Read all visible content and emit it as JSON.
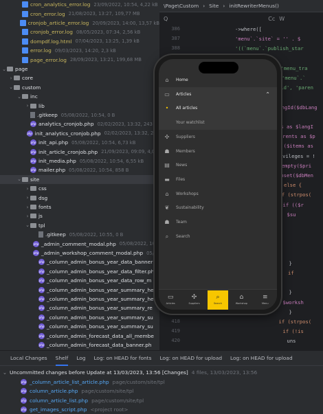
{
  "tree": {
    "rows": [
      {
        "name": "cron_analytics_error.log",
        "meta": "23/09/2022, 10:54, 4,22 kB",
        "kind": "log",
        "yellow": true,
        "indent": 24,
        "chev": ""
      },
      {
        "name": "cron_error.log",
        "meta": "21/08/2023, 13:27, 109,77 MB",
        "kind": "log",
        "yellow": true,
        "indent": 24,
        "chev": ""
      },
      {
        "name": "cronjob_article_error.log",
        "meta": "20/09/2023, 14:00, 13,57 kB",
        "kind": "log",
        "yellow": true,
        "indent": 24,
        "chev": ""
      },
      {
        "name": "cronjob_error.log",
        "meta": "08/05/2023, 07:34, 2,56 kB",
        "kind": "log",
        "yellow": true,
        "indent": 24,
        "chev": ""
      },
      {
        "name": "dompdf.log.html",
        "meta": "07/04/2023, 13:25, 1,39 kB",
        "kind": "html",
        "yellow": true,
        "indent": 24,
        "chev": ""
      },
      {
        "name": "error.log",
        "meta": "09/03/2023, 14:20, 2,3 kB",
        "kind": "log",
        "yellow": true,
        "indent": 24,
        "chev": ""
      },
      {
        "name": "page_error.log",
        "meta": "28/09/2023, 13:21, 199,68 MB",
        "kind": "log",
        "yellow": true,
        "indent": 24,
        "chev": ""
      },
      {
        "name": "page",
        "meta": "",
        "kind": "folder",
        "yellow": false,
        "indent": 2,
        "chev": "⌄"
      },
      {
        "name": "core",
        "meta": "",
        "kind": "folder",
        "yellow": false,
        "indent": 12,
        "chev": "›"
      },
      {
        "name": "custom",
        "meta": "",
        "kind": "folder",
        "yellow": false,
        "indent": 12,
        "chev": "⌄"
      },
      {
        "name": "inc",
        "meta": "",
        "kind": "folder",
        "yellow": false,
        "indent": 24,
        "chev": "⌄"
      },
      {
        "name": "lib",
        "meta": "",
        "kind": "folder",
        "yellow": false,
        "indent": 36,
        "chev": "›"
      },
      {
        "name": ".gitkeep",
        "meta": "05/08/2022, 10:54, 0 B",
        "kind": "file",
        "yellow": false,
        "indent": 36,
        "chev": ""
      },
      {
        "name": "analytics_cronjob.php",
        "meta": "02/02/2023, 13:32, 243",
        "kind": "php",
        "yellow": false,
        "indent": 36,
        "chev": ""
      },
      {
        "name": "init_analytics_cronjob.php",
        "meta": "02/02/2023, 13:32, 243",
        "kind": "php",
        "yellow": false,
        "indent": 36,
        "chev": ""
      },
      {
        "name": "init_api.php",
        "meta": "05/08/2022, 10:54, 6,73 kB",
        "kind": "php",
        "yellow": false,
        "indent": 36,
        "chev": ""
      },
      {
        "name": "init_article_cronjob.php",
        "meta": "21/09/2023, 09:09, 4,0",
        "kind": "php",
        "yellow": false,
        "indent": 36,
        "chev": ""
      },
      {
        "name": "init_media.php",
        "meta": "05/08/2022, 10:54, 6,55 kB",
        "kind": "php",
        "yellow": false,
        "indent": 36,
        "chev": ""
      },
      {
        "name": "mailer.php",
        "meta": "05/08/2022, 10:54, 858 B",
        "kind": "php",
        "yellow": false,
        "indent": 36,
        "chev": ""
      },
      {
        "name": "site",
        "meta": "",
        "kind": "folder",
        "yellow": false,
        "indent": 24,
        "chev": "⌄",
        "sel": true
      },
      {
        "name": "css",
        "meta": "",
        "kind": "folder",
        "yellow": false,
        "indent": 36,
        "chev": "›"
      },
      {
        "name": "dsg",
        "meta": "",
        "kind": "folder",
        "yellow": false,
        "indent": 36,
        "chev": "›"
      },
      {
        "name": "fonts",
        "meta": "",
        "kind": "folder",
        "yellow": false,
        "indent": 36,
        "chev": "›"
      },
      {
        "name": "js",
        "meta": "",
        "kind": "folder",
        "yellow": false,
        "indent": 36,
        "chev": "›"
      },
      {
        "name": "tpl",
        "meta": "",
        "kind": "folder",
        "yellow": false,
        "indent": 36,
        "chev": "⌄"
      },
      {
        "name": ".gitkeep",
        "meta": "05/08/2022, 10:55, 0 B",
        "kind": "file",
        "yellow": false,
        "indent": 48,
        "chev": ""
      },
      {
        "name": "_admin_comment_modal.php",
        "meta": "05/08/2022, 10:54, 1,36 kB",
        "kind": "php",
        "yellow": false,
        "indent": 48,
        "chev": ""
      },
      {
        "name": "_admin_workshop_comment_modal.php",
        "meta": "05/08/2022",
        "kind": "php",
        "yellow": false,
        "indent": 48,
        "chev": ""
      },
      {
        "name": "_column_admin_bonus_year_data_banner",
        "meta": "",
        "kind": "php",
        "yellow": false,
        "indent": 48,
        "chev": ""
      },
      {
        "name": "_column_admin_bonus_year_data_filter.ph",
        "meta": "",
        "kind": "php",
        "yellow": false,
        "indent": 48,
        "chev": ""
      },
      {
        "name": "_column_admin_bonus_year_data_row_m",
        "meta": "",
        "kind": "php",
        "yellow": false,
        "indent": 48,
        "chev": ""
      },
      {
        "name": "_column_admin_bonus_year_summary_he",
        "meta": "",
        "kind": "php",
        "yellow": false,
        "indent": 48,
        "chev": ""
      },
      {
        "name": "_column_admin_bonus_year_summary_he",
        "meta": "",
        "kind": "php",
        "yellow": false,
        "indent": 48,
        "chev": ""
      },
      {
        "name": "_column_admin_bonus_year_summary_re",
        "meta": "",
        "kind": "php",
        "yellow": false,
        "indent": 48,
        "chev": ""
      },
      {
        "name": "_column_admin_bonus_year_summary_su",
        "meta": "",
        "kind": "php",
        "yellow": false,
        "indent": 48,
        "chev": ""
      },
      {
        "name": "_column_admin_bonus_year_summary_su",
        "meta": "",
        "kind": "php",
        "yellow": false,
        "indent": 48,
        "chev": ""
      },
      {
        "name": "_column_admin_forecast_data_all_membe",
        "meta": "",
        "kind": "php",
        "yellow": false,
        "indent": 48,
        "chev": ""
      },
      {
        "name": "_column_admin_forecast_data_banner.ph",
        "meta": "",
        "kind": "php",
        "yellow": false,
        "indent": 48,
        "chev": ""
      }
    ]
  },
  "editor": {
    "breadcrumb": [
      "\\Page\\Custom",
      "Site",
      "initRewriterMenus()"
    ],
    "toolbar": {
      "search_icon": "Q",
      "cc": "Cc",
      "w": "W",
      ".*": ".*"
    },
    "lines": [
      {
        "n": "386",
        "c": "->where(["
      },
      {
        "n": "387",
        "c": "'menu`.`site` = '' . $"
      },
      {
        "n": "388",
        "c": "'((`menu`.`publish_star"
      },
      {
        "n": "",
        "c": ""
      },
      {
        "n": "",
        "c": "'menu_tra"
      },
      {
        "n": "",
        "c": "'menu`.`"
      },
      {
        "n": "",
        "c": "_id', 'paren"
      },
      {
        "n": "",
        "c": ""
      },
      {
        "n": "",
        "c": "langId($dbLang"
      },
      {
        "n": "",
        "c": ""
      },
      {
        "n": "",
        "c": "us as $langI"
      },
      {
        "n": "",
        "c": "parents as $p"
      },
      {
        "n": "",
        "c": "h ($items as"
      },
      {
        "n": "",
        "c": "rivileges = !"
      },
      {
        "n": "",
        "c": "(empty($pri"
      },
      {
        "n": "",
        "c": "unset($dbMen"
      },
      {
        "n": "",
        "c": "else {"
      },
      {
        "n": "",
        "c": "if (strpos("
      },
      {
        "n": "",
        "c": "if (($r"
      },
      {
        "n": "",
        "c": "$su"
      },
      {
        "n": "",
        "c": ""
      },
      {
        "n": "",
        "c": ""
      },
      {
        "n": "",
        "c": ""
      },
      {
        "n": "",
        "c": ""
      },
      {
        "n": "",
        "c": "}"
      },
      {
        "n": "",
        "c": "if"
      },
      {
        "n": "",
        "c": ""
      },
      {
        "n": "",
        "c": "}"
      },
      {
        "n": "",
        "c": "$worksh"
      },
      {
        "n": "",
        "c": "}"
      },
      {
        "n": "418",
        "c": "if (strpos("
      },
      {
        "n": "419",
        "c": "if (!is"
      },
      {
        "n": "420",
        "c": "uns"
      }
    ]
  },
  "phone": {
    "menu": [
      {
        "label": "Home",
        "icon": "⌂",
        "dim": false
      },
      {
        "label": "Articles",
        "icon": "▭",
        "dim": false,
        "expanded": true
      },
      {
        "label": "All articles",
        "icon": "•",
        "dim": false,
        "sub": true,
        "active": true
      },
      {
        "label": "Your watchlist",
        "icon": "",
        "dim": true,
        "sub": true
      },
      {
        "label": "Suppliers",
        "icon": "✣",
        "dim": true
      },
      {
        "label": "Members",
        "icon": "☗",
        "dim": true
      },
      {
        "label": "News",
        "icon": "▤",
        "dim": true
      },
      {
        "label": "Files",
        "icon": "▬",
        "dim": true
      },
      {
        "label": "Workshops",
        "icon": "⌂",
        "dim": true
      },
      {
        "label": "Sustainability",
        "icon": "❦",
        "dim": true
      },
      {
        "label": "Team",
        "icon": "☗",
        "dim": true
      },
      {
        "label": "Search",
        "icon": "⌕",
        "dim": true
      }
    ],
    "bottom_nav": [
      {
        "label": "Articles",
        "icon": "▭",
        "active": false
      },
      {
        "label": "Suppliers",
        "icon": "✣",
        "active": false
      },
      {
        "label": "Search",
        "icon": "⌕",
        "active": true
      },
      {
        "label": "Workshop",
        "icon": "⌂",
        "active": false
      },
      {
        "label": "Menu",
        "icon": "≡",
        "active": false
      }
    ]
  },
  "bottom_panel": {
    "tabs": [
      "Local Changes",
      "Shelf",
      "Log",
      "Log: on HEAD for fonts",
      "Log: on HEAD for upload",
      "Log: on HEAD for upload"
    ],
    "active_tab": "Shelf",
    "changelist": {
      "title": "Uncommitted changes before Update at 13/03/2023, 13:56 [Changes]",
      "info": "4 files, 13/03/2023, 13:56"
    },
    "files": [
      {
        "name": "_column_article_list_article.php",
        "path": "page/custom/site/tpl"
      },
      {
        "name": "column_article.php",
        "path": "page/custom/site/tpl"
      },
      {
        "name": "column_article_list.php",
        "path": "page/custom/site/tpl"
      },
      {
        "name": "get_images_script.php",
        "path": "<project root>"
      }
    ]
  },
  "colors": {
    "accent": "#f7c600",
    "tree_bg": "#2b2d30",
    "editor_bg": "#1e1f22",
    "link": "#56a8f5"
  }
}
